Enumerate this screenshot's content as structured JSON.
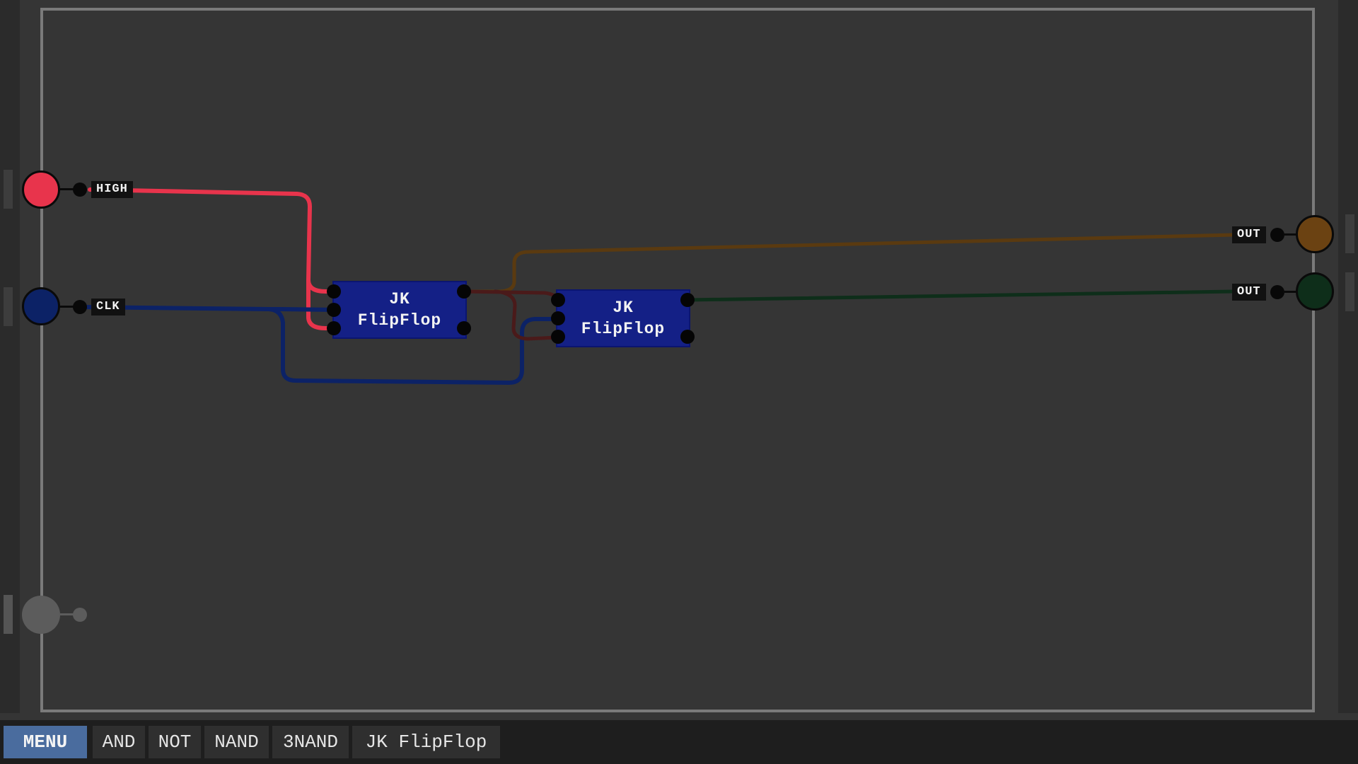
{
  "menu_label": "MENU",
  "palette": [
    "AND",
    "NOT",
    "NAND",
    "3NAND",
    "JK FlipFlop"
  ],
  "inputs": [
    {
      "label": "HIGH",
      "color": "#e8344c"
    },
    {
      "label": "CLK",
      "color": "#0c2266"
    },
    {
      "label": "",
      "color": "#5c5c5c"
    }
  ],
  "outputs": [
    {
      "label": "OUT",
      "color": "#6b4212"
    },
    {
      "label": "OUT",
      "color": "#0e2e1a"
    }
  ],
  "chips": [
    {
      "line1": "JK",
      "line2": "FlipFlop"
    },
    {
      "line1": "JK",
      "line2": "FlipFlop"
    }
  ],
  "wire_colors": {
    "high": "#e8344c",
    "clk": "#0c2266",
    "q1": "#5a3a10",
    "q1_not": "#4a1a1a",
    "q2": "#0e2e1a"
  }
}
